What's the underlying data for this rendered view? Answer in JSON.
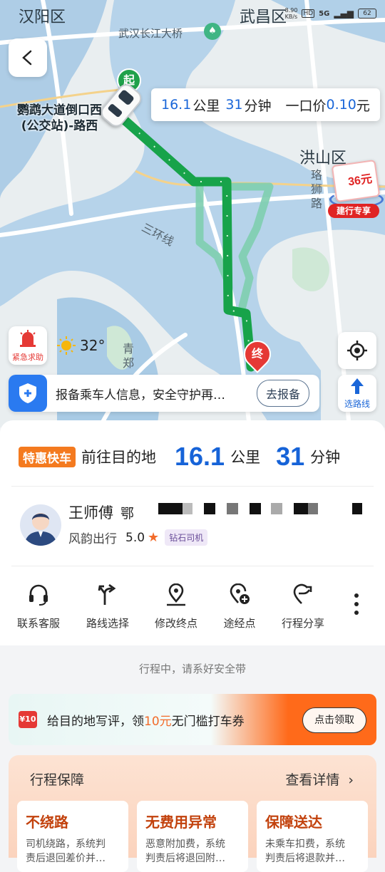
{
  "status_bar": {
    "net_speed": "8.90\nKB/s",
    "hd": "HD",
    "signal": "5G",
    "battery": "62"
  },
  "map": {
    "districts": {
      "hanyang": "汉阳区",
      "wuchang": "武昌区",
      "hongshan": "洪山区"
    },
    "bridge": "武汉长江大桥",
    "road_luoshi": "珞\n狮\n路",
    "road_sanhuan": "三环线",
    "road_qing": "青\n郑",
    "start_marker": "起",
    "end_marker": "终",
    "pickup_label": "鹦鹉大道倒口西\n(公交站)-路西"
  },
  "route_tip": {
    "distance": "16.1",
    "distance_unit": "公里",
    "duration": "31",
    "duration_unit": "分钟",
    "price_label": "一口价",
    "price": "0.10",
    "price_unit": "元"
  },
  "promo": {
    "amount": "36元",
    "label": "建行专享"
  },
  "sos": {
    "label": "紧急求助"
  },
  "weather": {
    "temp": "32°"
  },
  "safety": {
    "text": "报备乘车人信息，安全守护再…",
    "button": "去报备"
  },
  "route_select": {
    "label": "选路线"
  },
  "trip": {
    "tag": "特惠快车",
    "heading": "前往目的地",
    "distance": "16.1",
    "distance_unit": "公里",
    "duration": "31",
    "duration_unit": "分钟"
  },
  "driver": {
    "name": "王师傅",
    "plate_prefix": "鄂",
    "company": "风韵出行",
    "rating": "5.0",
    "badge": "钻石司机"
  },
  "actions": [
    {
      "label": "联系客服",
      "icon": "headset-icon"
    },
    {
      "label": "路线选择",
      "icon": "route-fork-icon"
    },
    {
      "label": "修改终点",
      "icon": "location-edit-icon"
    },
    {
      "label": "途经点",
      "icon": "waypoint-add-icon"
    },
    {
      "label": "行程分享",
      "icon": "share-icon"
    }
  ],
  "hint": "行程中，请系好安全带",
  "coupon": {
    "icon_text": "¥10",
    "text_pre": "给目的地写评，领",
    "amount": "10元",
    "text_post": "无门槛打车券",
    "button": "点击领取"
  },
  "protection": {
    "title": "行程保障",
    "details": "查看详情",
    "cards": [
      {
        "title": "不绕路",
        "desc": "司机绕路，系统判\n责后退回差价并…"
      },
      {
        "title": "无费用异常",
        "desc": "恶意附加费，系统\n判责后将退回附…"
      },
      {
        "title": "保障送达",
        "desc": "未乘车扣费，系统\n判责后将退款并…"
      }
    ]
  },
  "colors": {
    "accent": "#1a66d8",
    "route": "#17a34a",
    "alt_route": "#7fcfb0",
    "orange": "#f47a1f"
  }
}
